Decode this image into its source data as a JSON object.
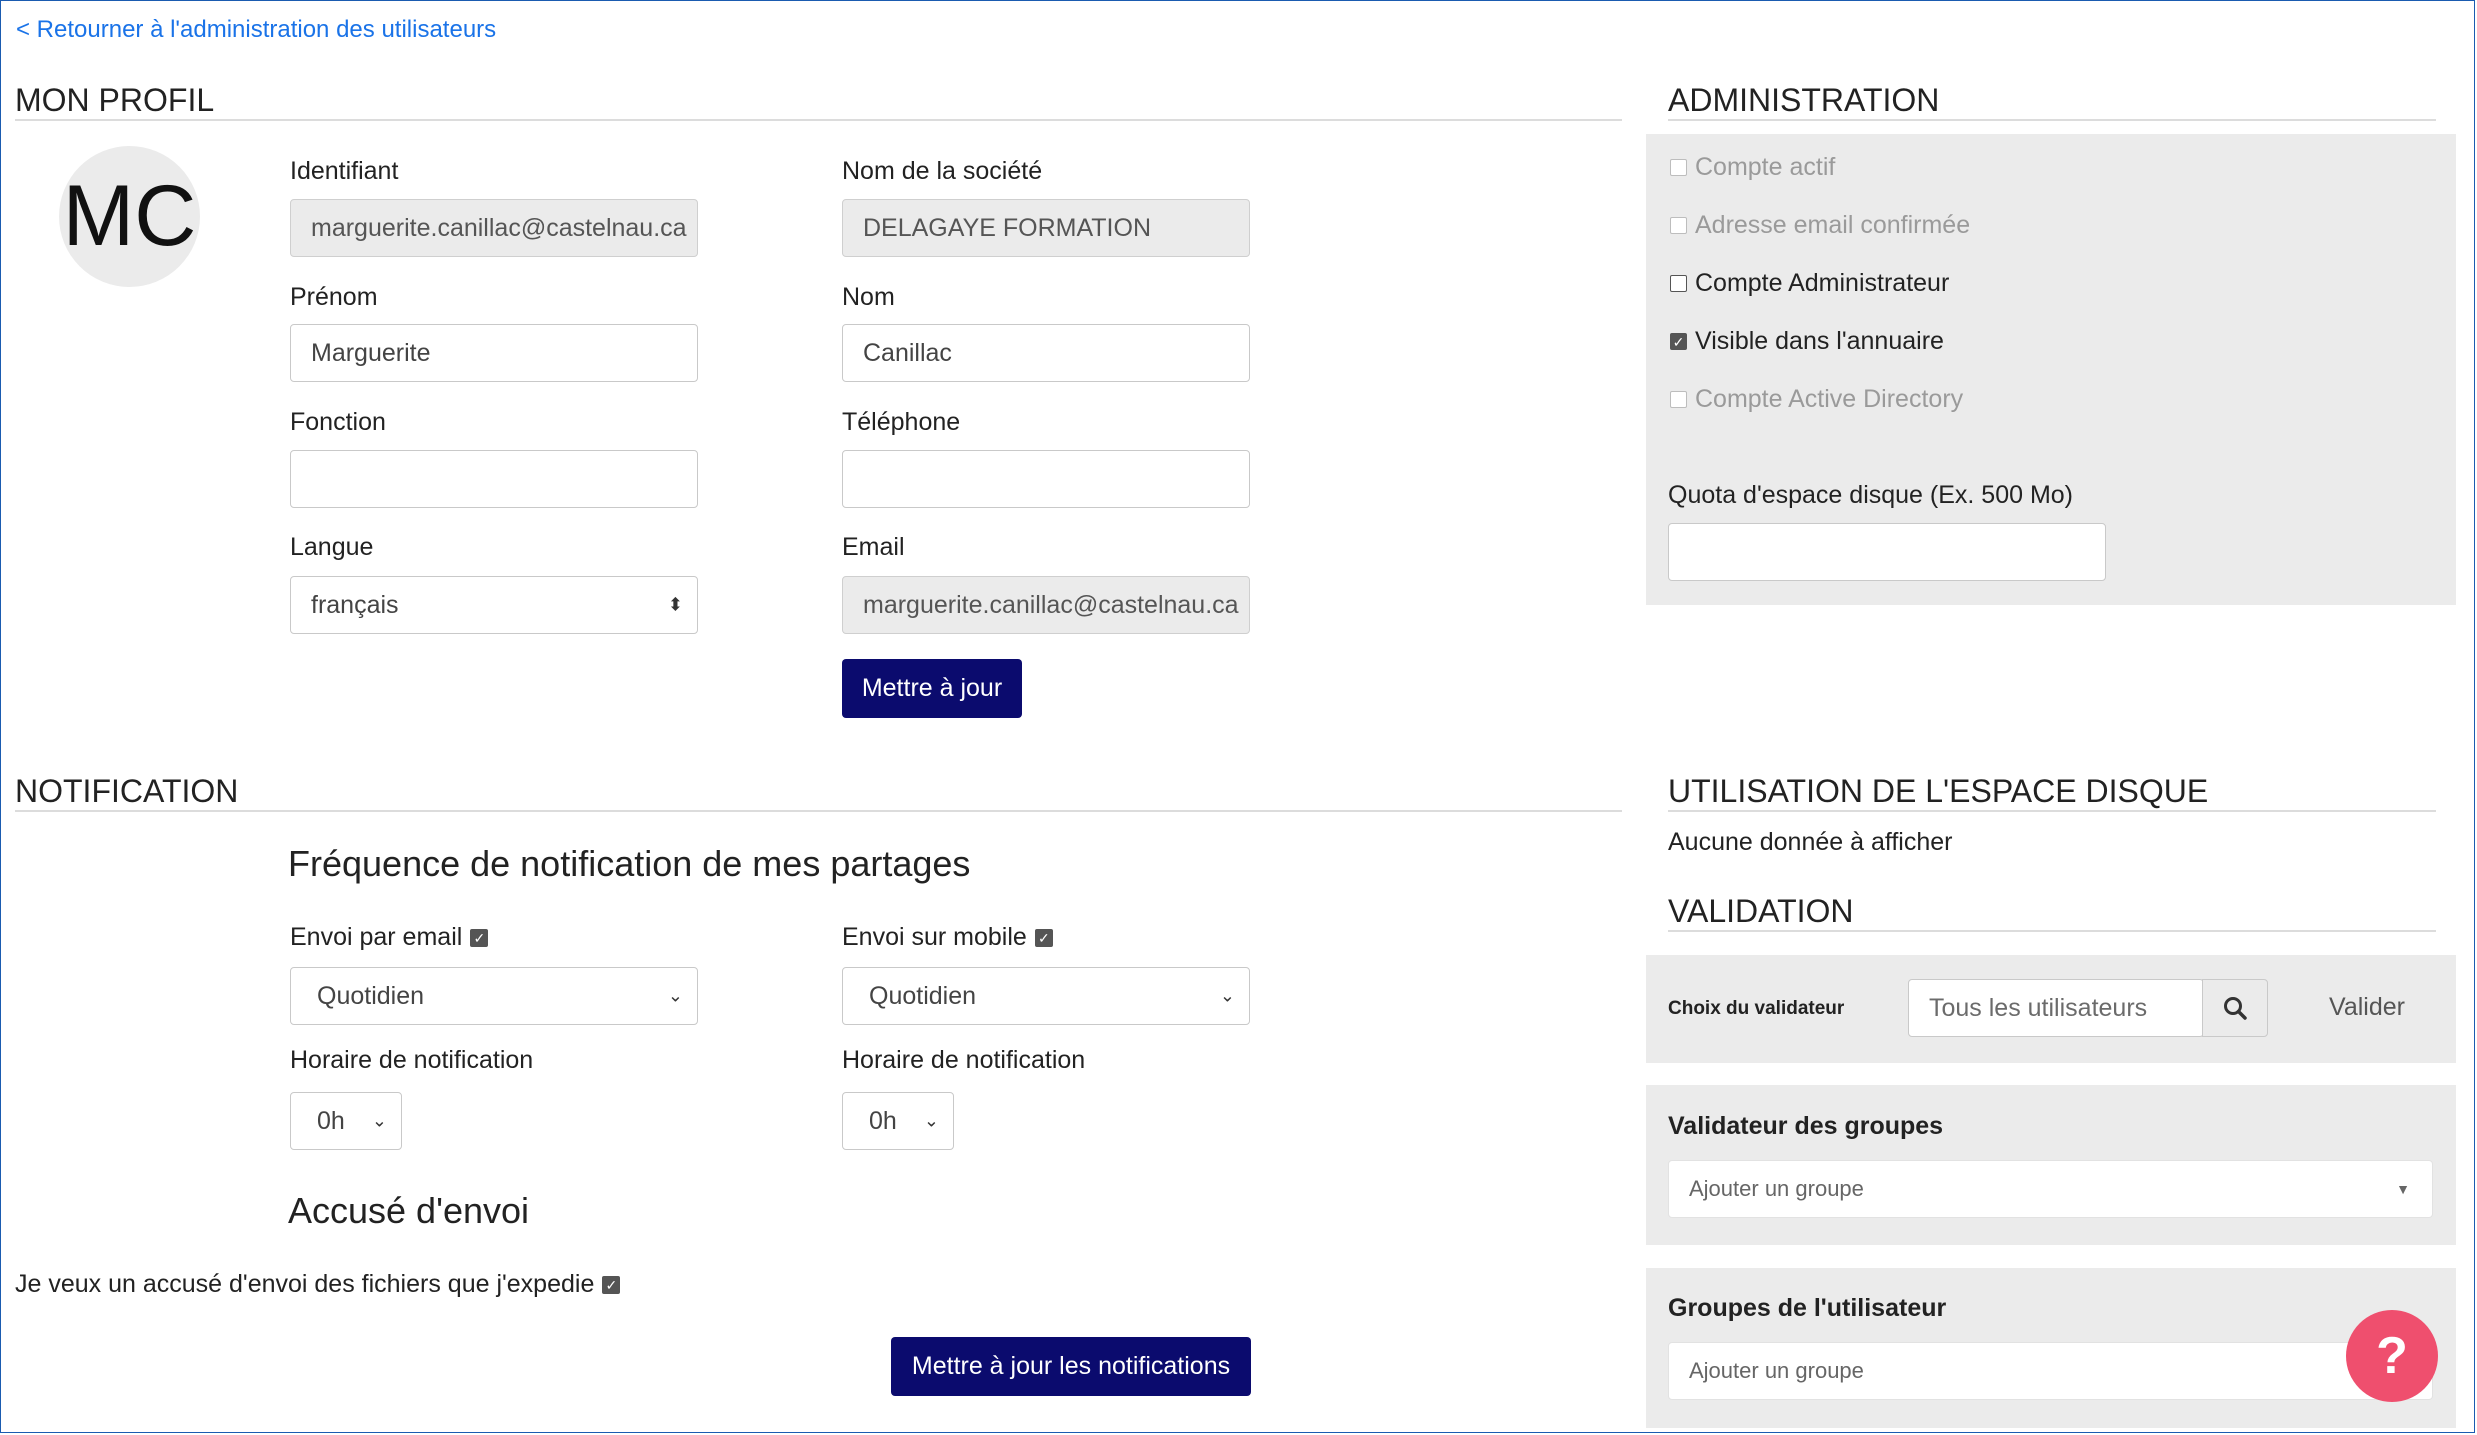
{
  "back_link": "< Retourner à l'administration des utilisateurs",
  "profile": {
    "title": "MON PROFIL",
    "avatar_initials": "MC",
    "fields": {
      "identifiant": {
        "label": "Identifiant",
        "value": "marguerite.canillac@castelnau.ca"
      },
      "societe": {
        "label": "Nom de la société",
        "value": "DELAGAYE FORMATION"
      },
      "prenom": {
        "label": "Prénom",
        "value": "Marguerite"
      },
      "nom": {
        "label": "Nom",
        "value": "Canillac"
      },
      "fonction": {
        "label": "Fonction",
        "value": ""
      },
      "telephone": {
        "label": "Téléphone",
        "value": ""
      },
      "langue": {
        "label": "Langue",
        "value": "français"
      },
      "email": {
        "label": "Email",
        "value": "marguerite.canillac@castelnau.ca"
      }
    },
    "update_button": "Mettre à jour"
  },
  "administration": {
    "title": "ADMINISTRATION",
    "checkboxes": [
      {
        "label": "Compte actif",
        "checked": false,
        "disabled": true
      },
      {
        "label": "Adresse email confirmée",
        "checked": false,
        "disabled": true
      },
      {
        "label": "Compte Administrateur",
        "checked": false,
        "disabled": false
      },
      {
        "label": "Visible dans l'annuaire",
        "checked": true,
        "disabled": false
      },
      {
        "label": "Compte Active Directory",
        "checked": false,
        "disabled": true
      }
    ],
    "quota_label": "Quota d'espace disque (Ex. 500 Mo)",
    "quota_value": ""
  },
  "notification": {
    "title": "NOTIFICATION",
    "frequency_heading": "Fréquence de notification de mes partages",
    "email_label": "Envoi par email",
    "mobile_label": "Envoi sur mobile",
    "email_frequency": "Quotidien",
    "mobile_frequency": "Quotidien",
    "schedule_label_email": "Horaire de notification",
    "schedule_label_mobile": "Horaire de notification",
    "email_hour": "0h",
    "mobile_hour": "0h",
    "receipt_heading": "Accusé d'envoi",
    "receipt_label": "Je veux un accusé d'envoi des fichiers que j'expedie",
    "update_button": "Mettre à jour les notifications"
  },
  "disk_usage": {
    "title": "UTILISATION DE L'ESPACE DISQUE",
    "empty_text": "Aucune donnée à afficher"
  },
  "validation": {
    "title": "VALIDATION",
    "validator_label": "Choix du validateur",
    "search_placeholder": "Tous les utilisateurs",
    "validate_button": "Valider",
    "group_validator_title": "Validateur des groupes",
    "group_validator_placeholder": "Ajouter un groupe",
    "user_groups_title": "Groupes de l'utilisateur",
    "user_groups_placeholder": "Ajouter un groupe"
  },
  "help_button": "?"
}
